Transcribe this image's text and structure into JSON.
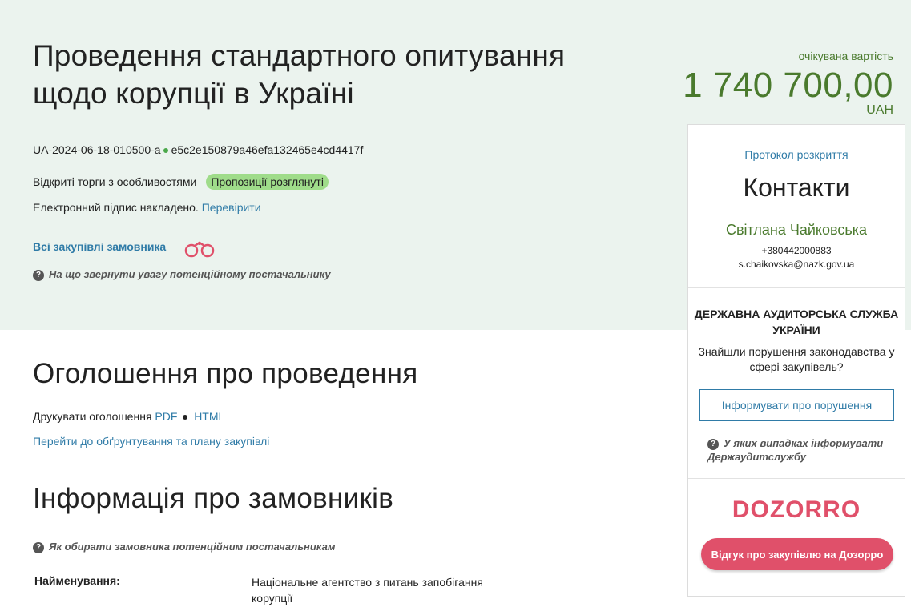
{
  "tender": {
    "title": "Проведення стандартного опитування щодо корупції в Україні",
    "id": "UA-2024-06-18-010500-a",
    "hash": "e5c2e150879a46efa132465e4cd4417f",
    "procedure": "Відкриті торги з особливостями",
    "status_badge": "Пропозиції розглянуті",
    "signature_text": "Електронний підпис накладено.",
    "signature_link": "Перевірити",
    "all_purchases_link": "Всі закупівлі замовника",
    "attention_hint": "На що звернути увагу потенційному постачальнику"
  },
  "cost": {
    "label": "очікувана вартість",
    "value": "1 740 700,00",
    "currency": "UAH"
  },
  "announcement": {
    "heading": "Оголошення про проведення",
    "print_label": "Друкувати оголошення",
    "pdf": "PDF",
    "html": "HTML",
    "plan_link": "Перейти до обґрунтування та плану закупівлі"
  },
  "customers": {
    "heading": "Інформація про замовників",
    "hint": "Як обирати замовника потенційним постачальникам",
    "name_label": "Найменування:",
    "name_value": "Національне агентство з питань запобігання корупції"
  },
  "sidebar": {
    "protocol_link": "Протокол розкриття",
    "contacts_title": "Контакти",
    "contact_name": "Світлана Чайковська",
    "phone": "+380442000883",
    "email": "s.chaikovska@nazk.gov.ua",
    "audit_title": "ДЕРЖАВНА АУДИТОРСЬКА СЛУЖБА УКРАЇНИ",
    "audit_question": "Знайшли порушення законодавства у сфері закупівель?",
    "report_button": "Інформувати про порушення",
    "when_hint": "У яких випадках інформувати Держаудитслужбу",
    "dozorro_logo": "DOZORRO",
    "feedback_button": "Відгук про закупівлю на Дозорро"
  },
  "colors": {
    "hero_bg": "#ebf3ee",
    "accent_green": "#4a7a2d",
    "link_blue": "#2f7ba7",
    "badge_green": "#9fdc8a",
    "dozorro_pink": "#e0506a"
  },
  "icons": [
    "binoculars-icon",
    "question-icon"
  ]
}
